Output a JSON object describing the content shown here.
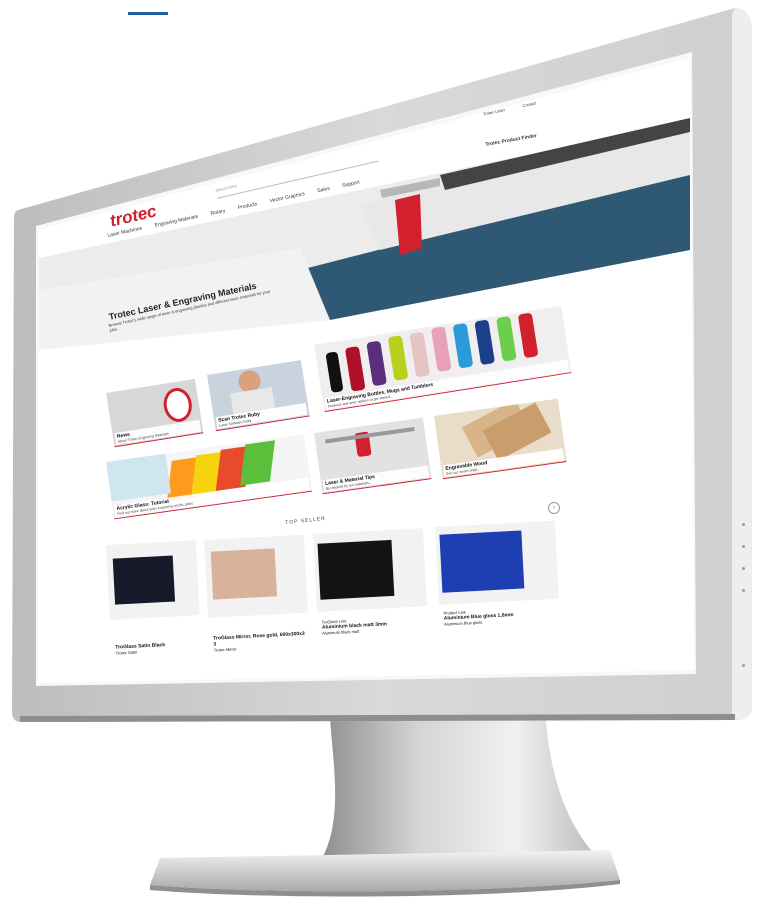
{
  "site": {
    "logo": "trotec",
    "search_placeholder": "Search here",
    "nav": [
      "Laser Machines",
      "Engraving Materials",
      "Rotary",
      "Products",
      "Vector Graphics",
      "Sales",
      "Support"
    ],
    "meta_links": [
      {
        "label": "Trotec Laser",
        "icon": "globe-icon"
      },
      {
        "label": "Contact",
        "icon": "user-icon"
      }
    ],
    "brand_line": "Trotec Product Finder"
  },
  "hero": {
    "title": "Trotec Laser & Engraving Materials",
    "subtitle": "Browse Trotec's wide range of laser & engraving plastics and different laser materials for your jobs."
  },
  "tiles": [
    {
      "title": "News",
      "subtitle": "About Trotec Engraving Materials"
    },
    {
      "title": "Scan Trotec Ruby",
      "subtitle": "Laser Software Ruby"
    },
    {
      "title": "Laser-Engraving Bottles, Mugs and Tumblers",
      "subtitle": "Products and laser options to get started..."
    },
    {
      "title": "Acrylic Glass: Tutorial",
      "subtitle": "Find out more about laser engraving acrylic glass"
    },
    {
      "title": "Laser & Material Tips",
      "subtitle": "Be inspired by our materials..."
    },
    {
      "title": "Engravable Wood",
      "subtitle": "See our wood range..."
    }
  ],
  "top_seller": {
    "heading": "TOP SELLER",
    "products": [
      {
        "category": "",
        "name": "TroGlass Satin Black",
        "detail": "Trotec Satin"
      },
      {
        "category": "",
        "name": "TroGlass Mirror, Rose gold, 600x300x3 3",
        "detail": "Trotec Mirror"
      },
      {
        "category": "TroGlass Line",
        "name": "Aluminium black matt 3mm",
        "detail": "Aluminum black matt"
      },
      {
        "category": "Product Line",
        "name": "Aluminium Blue gloss 1,6mm",
        "detail": "Aluminium Blue gloss"
      }
    ]
  },
  "colors": {
    "brand_red": "#d2202f",
    "accent_blue": "#1f5fa8"
  }
}
